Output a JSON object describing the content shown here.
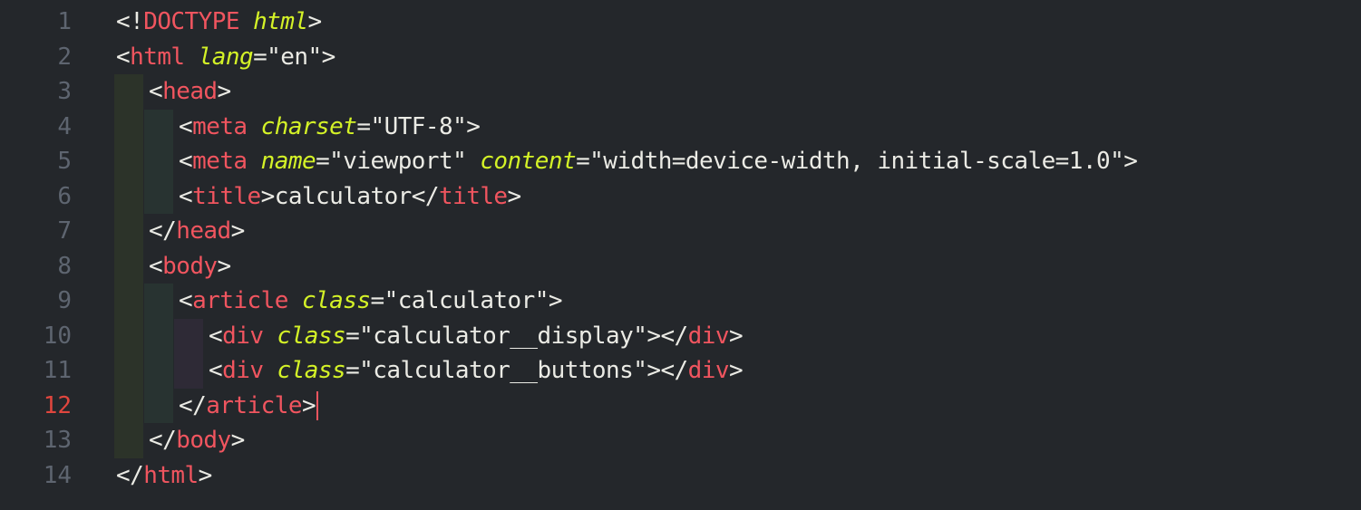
{
  "editor": {
    "active_line": 12,
    "lines": [
      {
        "n": "1",
        "indent": 0,
        "tokens": [
          [
            "punct",
            "<!"
          ],
          [
            "tag",
            "DOCTYPE"
          ],
          [
            "punct",
            " "
          ],
          [
            "attr",
            "html"
          ],
          [
            "punct",
            ">"
          ]
        ]
      },
      {
        "n": "2",
        "indent": 0,
        "tokens": [
          [
            "punct",
            "<"
          ],
          [
            "tag",
            "html"
          ],
          [
            "punct",
            " "
          ],
          [
            "attr",
            "lang"
          ],
          [
            "punct",
            "="
          ],
          [
            "str",
            "\"en\""
          ],
          [
            "punct",
            ">"
          ]
        ]
      },
      {
        "n": "3",
        "indent": 1,
        "tokens": [
          [
            "punct",
            "<"
          ],
          [
            "tag",
            "head"
          ],
          [
            "punct",
            ">"
          ]
        ]
      },
      {
        "n": "4",
        "indent": 2,
        "tokens": [
          [
            "punct",
            "<"
          ],
          [
            "tag",
            "meta"
          ],
          [
            "punct",
            " "
          ],
          [
            "attr",
            "charset"
          ],
          [
            "punct",
            "="
          ],
          [
            "str",
            "\"UTF-8\""
          ],
          [
            "punct",
            ">"
          ]
        ]
      },
      {
        "n": "5",
        "indent": 2,
        "tokens": [
          [
            "punct",
            "<"
          ],
          [
            "tag",
            "meta"
          ],
          [
            "punct",
            " "
          ],
          [
            "attr",
            "name"
          ],
          [
            "punct",
            "="
          ],
          [
            "str",
            "\"viewport\""
          ],
          [
            "punct",
            " "
          ],
          [
            "attr",
            "content"
          ],
          [
            "punct",
            "="
          ],
          [
            "str",
            "\"width=device-width, initial-scale=1.0\""
          ],
          [
            "punct",
            ">"
          ]
        ]
      },
      {
        "n": "6",
        "indent": 2,
        "tokens": [
          [
            "punct",
            "<"
          ],
          [
            "tag",
            "title"
          ],
          [
            "punct",
            ">"
          ],
          [
            "txt",
            "calculator"
          ],
          [
            "punct",
            "</"
          ],
          [
            "tag",
            "title"
          ],
          [
            "punct",
            ">"
          ]
        ]
      },
      {
        "n": "7",
        "indent": 1,
        "tokens": [
          [
            "punct",
            "</"
          ],
          [
            "tag",
            "head"
          ],
          [
            "punct",
            ">"
          ]
        ]
      },
      {
        "n": "8",
        "indent": 1,
        "tokens": [
          [
            "punct",
            "<"
          ],
          [
            "tag",
            "body"
          ],
          [
            "punct",
            ">"
          ]
        ]
      },
      {
        "n": "9",
        "indent": 2,
        "tokens": [
          [
            "punct",
            "<"
          ],
          [
            "tag",
            "article"
          ],
          [
            "punct",
            " "
          ],
          [
            "attr",
            "class"
          ],
          [
            "punct",
            "="
          ],
          [
            "str",
            "\"calculator\""
          ],
          [
            "punct",
            ">"
          ]
        ]
      },
      {
        "n": "10",
        "indent": 3,
        "tokens": [
          [
            "punct",
            "<"
          ],
          [
            "tag",
            "div"
          ],
          [
            "punct",
            " "
          ],
          [
            "attr",
            "class"
          ],
          [
            "punct",
            "="
          ],
          [
            "str",
            "\"calculator__display\""
          ],
          [
            "punct",
            "></"
          ],
          [
            "tag",
            "div"
          ],
          [
            "punct",
            ">"
          ]
        ]
      },
      {
        "n": "11",
        "indent": 3,
        "tokens": [
          [
            "punct",
            "<"
          ],
          [
            "tag",
            "div"
          ],
          [
            "punct",
            " "
          ],
          [
            "attr",
            "class"
          ],
          [
            "punct",
            "="
          ],
          [
            "str",
            "\"calculator__buttons\""
          ],
          [
            "punct",
            "></"
          ],
          [
            "tag",
            "div"
          ],
          [
            "punct",
            ">"
          ]
        ]
      },
      {
        "n": "12",
        "indent": 2,
        "tokens": [
          [
            "punct",
            "</"
          ],
          [
            "tag",
            "article"
          ],
          [
            "punct",
            ">"
          ]
        ]
      },
      {
        "n": "13",
        "indent": 1,
        "tokens": [
          [
            "punct",
            "</"
          ],
          [
            "tag",
            "body"
          ],
          [
            "punct",
            ">"
          ]
        ]
      },
      {
        "n": "14",
        "indent": 0,
        "tokens": [
          [
            "punct",
            "</"
          ],
          [
            "tag",
            "html"
          ],
          [
            "punct",
            ">"
          ]
        ]
      }
    ]
  },
  "colors": {
    "background": "#24272b",
    "line_number": "#5e6570",
    "active_line_number": "#e0463e",
    "tag": "#f0555f",
    "attribute": "#d4f227",
    "text": "#ebebe5",
    "caret": "#f0555f"
  }
}
